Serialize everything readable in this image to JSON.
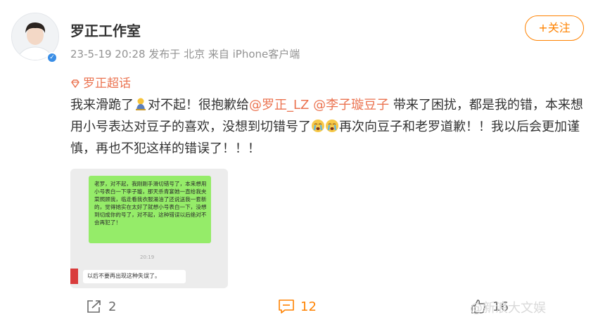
{
  "post": {
    "author": "罗正工作室",
    "meta": "23-5-19 20:28  发布于 北京  来自 iPhone客户端",
    "follow_label": "+关注",
    "topic": "罗正超话",
    "content": {
      "t1": "我来滑跪了",
      "t2": "对不起！很抱歉给",
      "mention1": "@罗正_LZ",
      "mention2": "@李子璇豆子",
      "t3": " 带来了困扰，都是我的错，本来想用小号表达对豆子的喜欢，没想到切错号了",
      "t4": "再次向豆子和老罗道歉！！我以后会更加谨慎，再也不犯这样的错误了！！！"
    },
    "chat": {
      "bubble": "老罗，对不起，我刚刚手滑切错号了，本来想用小号表白一下李子璇，那天杀青宴她一直给我夹菜照顾我，临走看我衣服湯油了还说送我一套新的，觉得她实在太好了就想小号表白一下，没想到切成你的号了，对不起，这种错误以后绝对不会再犯了！",
      "time": "20:19",
      "reply": "以后不要再出现这种失误了。"
    },
    "actions": {
      "share_count": "2",
      "comment_count": "12",
      "like_count": "16"
    },
    "watermark": "@新浪大文娱",
    "icons": [
      "verified-icon",
      "topic-diamond-icon",
      "kneel-emoji",
      "crying-emoji",
      "share-icon",
      "comment-icon",
      "like-icon"
    ],
    "colors": {
      "accent": "#ff8200",
      "link": "#eb7350",
      "chat_green": "#95ec69"
    }
  }
}
